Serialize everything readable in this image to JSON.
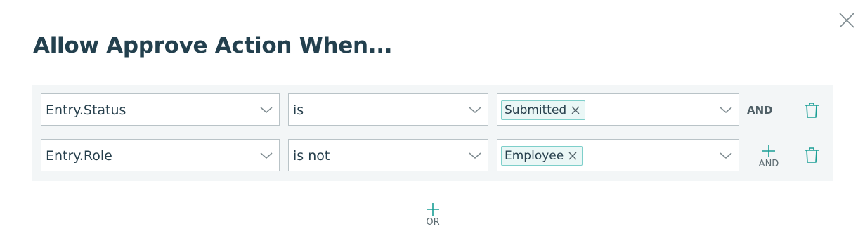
{
  "dialog": {
    "title": "Allow Approve Action When...",
    "close_icon": "close-icon"
  },
  "conditions": [
    {
      "field": "Entry.Status",
      "operator": "is",
      "values": [
        "Submitted"
      ],
      "connector": "AND"
    },
    {
      "field": "Entry.Role",
      "operator": "is not",
      "values": [
        "Employee"
      ],
      "add_connector_label": "AND"
    }
  ],
  "add_or_label": "OR",
  "colors": {
    "accent": "#1a9e95",
    "title": "#23404e",
    "panel_bg": "#f3f6f7",
    "chip_bg": "#eaf7f6",
    "chip_border": "#7ecfca"
  }
}
